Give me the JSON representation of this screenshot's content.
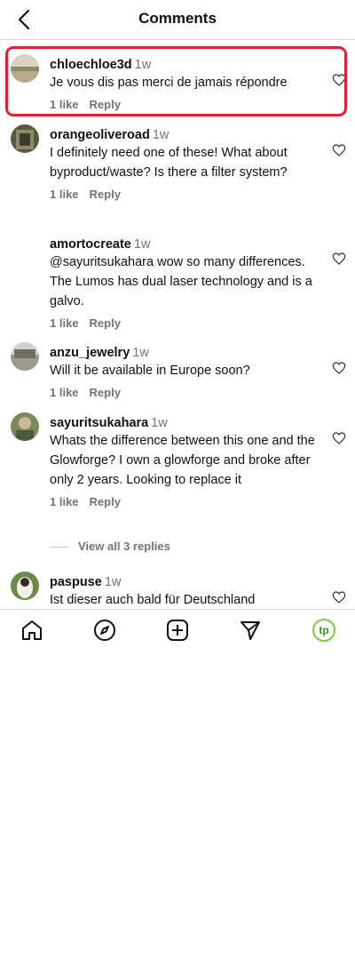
{
  "header": {
    "title": "Comments"
  },
  "comments": [
    {
      "username": "chloechloe3d",
      "time": "1w",
      "text": "Je vous dis pas merci de jamais répondre",
      "likes": "1 like",
      "reply": "Reply"
    },
    {
      "username": "orangeoliveroad",
      "time": "1w",
      "text": "I definitely need one of these! What about byproduct/waste? Is there a filter system?",
      "likes": "1 like",
      "reply": "Reply"
    },
    {
      "username": "amortocreate",
      "time": "1w",
      "text": "@sayuritsukahara wow so many differences. The Lumos has dual laser technology and is a galvo.",
      "likes": "1 like",
      "reply": "Reply"
    },
    {
      "username": "anzu_jewelry",
      "time": "1w",
      "text": "Will it be available in Europe soon?",
      "likes": "1 like",
      "reply": "Reply"
    },
    {
      "username": "sayuritsukahara",
      "time": "1w",
      "text": "Whats the difference between this one and the Glowforge? I own a glowforge and broke after only 2 years. Looking to replace it",
      "likes": "1 like",
      "reply": "Reply"
    },
    {
      "username": "paspuse",
      "time": "1w",
      "text": "Ist dieser auch bald für Deutschland"
    }
  ],
  "view_replies": "View all 3 replies",
  "tabbar": {
    "profile_initials": "tp"
  },
  "colors": {
    "highlight": "#e0212f",
    "profile_ring": "#7cc94a"
  }
}
